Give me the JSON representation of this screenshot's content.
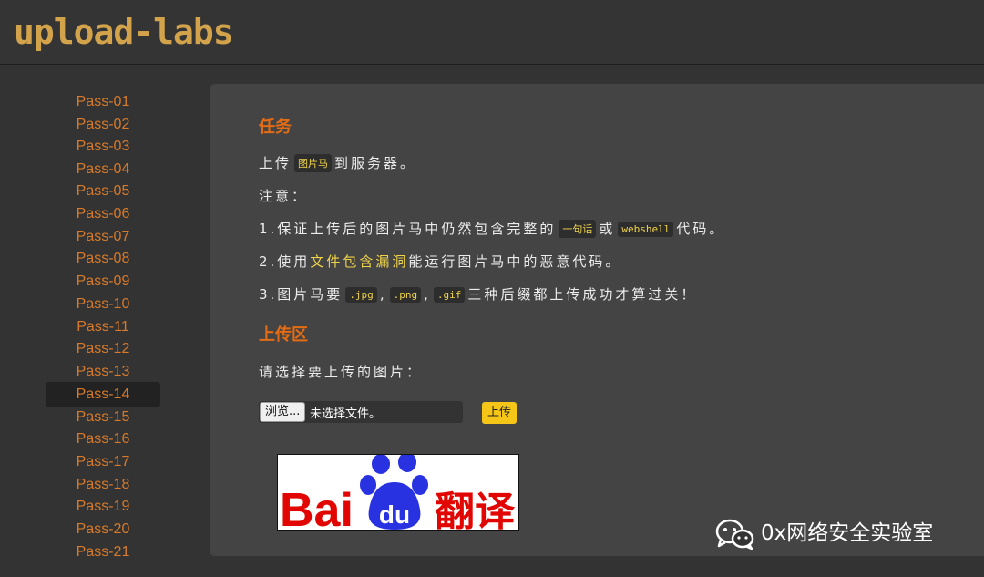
{
  "header": {
    "logo": "upload-labs"
  },
  "sidebar": {
    "items": [
      {
        "label": "Pass-01"
      },
      {
        "label": "Pass-02"
      },
      {
        "label": "Pass-03"
      },
      {
        "label": "Pass-04"
      },
      {
        "label": "Pass-05"
      },
      {
        "label": "Pass-06"
      },
      {
        "label": "Pass-07"
      },
      {
        "label": "Pass-08"
      },
      {
        "label": "Pass-09"
      },
      {
        "label": "Pass-10"
      },
      {
        "label": "Pass-11"
      },
      {
        "label": "Pass-12"
      },
      {
        "label": "Pass-13"
      },
      {
        "label": "Pass-14"
      },
      {
        "label": "Pass-15"
      },
      {
        "label": "Pass-16"
      },
      {
        "label": "Pass-17"
      },
      {
        "label": "Pass-18"
      },
      {
        "label": "Pass-19"
      },
      {
        "label": "Pass-20"
      },
      {
        "label": "Pass-21"
      }
    ],
    "active": "Pass-14"
  },
  "task": {
    "title": "任务",
    "line1": {
      "a": "上传",
      "code": "图片马",
      "b": "到服务器。"
    },
    "note": "注意：",
    "item1": {
      "a": "1.保证上传后的图片马中仍然包含完整的",
      "code1": "一句话",
      "b": "或",
      "code2": "webshell",
      "c": "代码。"
    },
    "item2": {
      "a": "2.使用",
      "hl": "文件包含漏洞",
      "b": "能运行图片马中的恶意代码。"
    },
    "item3": {
      "a": "3.图片马要",
      "code1": ".jpg",
      "sep1": ",",
      "code2": ".png",
      "sep2": ",",
      "code3": ".gif",
      "b": "三种后缀都上传成功才算过关！"
    }
  },
  "upload": {
    "title": "上传区",
    "prompt": "请选择要上传的图片：",
    "browse_label": "浏览...",
    "file_status": "未选择文件。",
    "upload_label": "上传"
  },
  "preview": {
    "logo_left": "Bai",
    "logo_paw": "du",
    "logo_right": "翻译"
  },
  "watermark": {
    "text": "0x网络安全实验室"
  },
  "colors": {
    "accent": "#e36c14",
    "sidebar_link": "#d87a2a",
    "code": "#f1d549",
    "upload_button": "#f5c518",
    "baidu_red": "#e10601",
    "baidu_blue": "#2932e1"
  }
}
